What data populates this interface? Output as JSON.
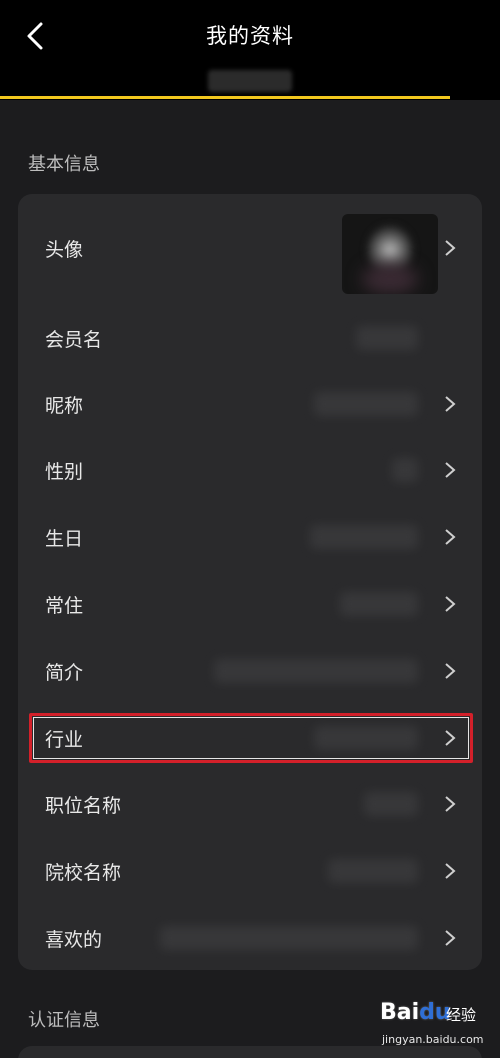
{
  "header": {
    "title": "我的资料"
  },
  "sections": {
    "basic": "基本信息",
    "cert": "认证信息"
  },
  "rows": [
    {
      "label": "头像",
      "has_chevron": true
    },
    {
      "label": "会员名",
      "has_chevron": false
    },
    {
      "label": "昵称",
      "has_chevron": true
    },
    {
      "label": "性别",
      "has_chevron": true
    },
    {
      "label": "生日",
      "has_chevron": true
    },
    {
      "label": "常住",
      "has_chevron": true
    },
    {
      "label": "简介",
      "has_chevron": true
    },
    {
      "label": "行业",
      "has_chevron": true,
      "highlighted": true
    },
    {
      "label": "职位名称",
      "has_chevron": true
    },
    {
      "label": "院校名称",
      "has_chevron": true
    },
    {
      "label": "喜欢的",
      "has_chevron": true
    }
  ],
  "watermark": {
    "logo": "Bai",
    "logo_paw": "du",
    "text": "经验",
    "url": "jingyan.baidu.com"
  },
  "colors": {
    "accent": "#f2c81e",
    "highlight": "#d3202a",
    "background": "#1c1c1e",
    "card": "#2a2a2c"
  }
}
